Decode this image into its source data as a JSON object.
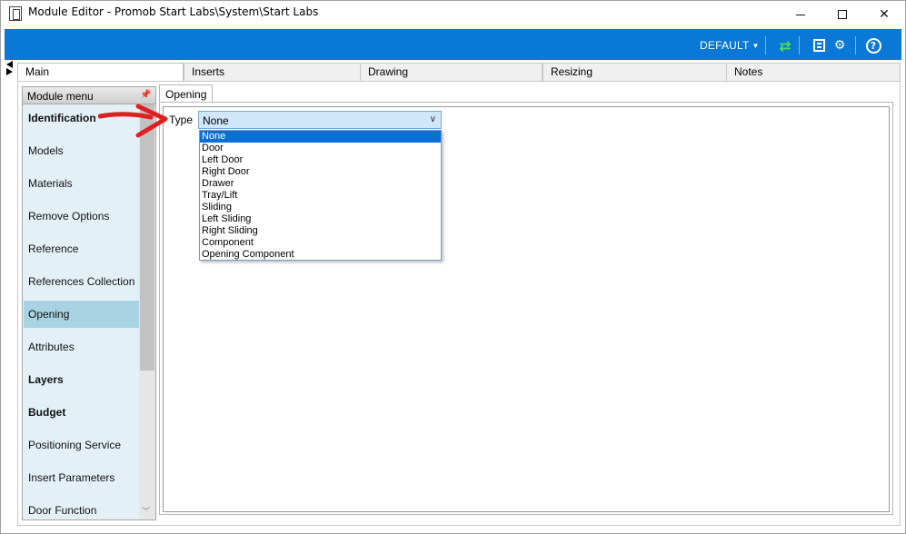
{
  "window": {
    "title": "Module Editor - Promob Start Labs\\System\\Start Labs"
  },
  "toolbar": {
    "profile_dropdown": "DEFAULT",
    "icons": [
      "refresh-icon",
      "tree-icon",
      "gears-icon",
      "help-icon"
    ],
    "accent_color": "#0a78d7"
  },
  "main_tabs": [
    {
      "label": "Main",
      "active": true
    },
    {
      "label": "Inserts",
      "active": false
    },
    {
      "label": "Drawing",
      "active": false
    },
    {
      "label": "Resizing",
      "active": false
    },
    {
      "label": "Notes",
      "active": false
    }
  ],
  "module_menu": {
    "header": "Module menu",
    "items": [
      {
        "label": "Identification",
        "bold": true,
        "selected": false
      },
      {
        "label": "Models",
        "bold": false,
        "selected": false
      },
      {
        "label": "Materials",
        "bold": false,
        "selected": false
      },
      {
        "label": "Remove Options",
        "bold": false,
        "selected": false
      },
      {
        "label": "Reference",
        "bold": false,
        "selected": false
      },
      {
        "label": "References Collection",
        "bold": false,
        "selected": false
      },
      {
        "label": "Opening",
        "bold": false,
        "selected": true
      },
      {
        "label": "Attributes",
        "bold": false,
        "selected": false
      },
      {
        "label": "Layers",
        "bold": true,
        "selected": false
      },
      {
        "label": "Budget",
        "bold": true,
        "selected": false
      },
      {
        "label": "Positioning Service",
        "bold": false,
        "selected": false
      },
      {
        "label": "Insert Parameters",
        "bold": false,
        "selected": false
      },
      {
        "label": "Door Function",
        "bold": false,
        "selected": false
      }
    ]
  },
  "opening_panel": {
    "tab_label": "Opening",
    "type_label": "Type",
    "type_value": "None",
    "type_options": [
      "None",
      "Door",
      "Left Door",
      "Right Door",
      "Drawer",
      "Tray/Lift",
      "Sliding",
      "Left Sliding",
      "Right Sliding",
      "Component",
      "Opening Component"
    ],
    "selected_option": "None"
  }
}
